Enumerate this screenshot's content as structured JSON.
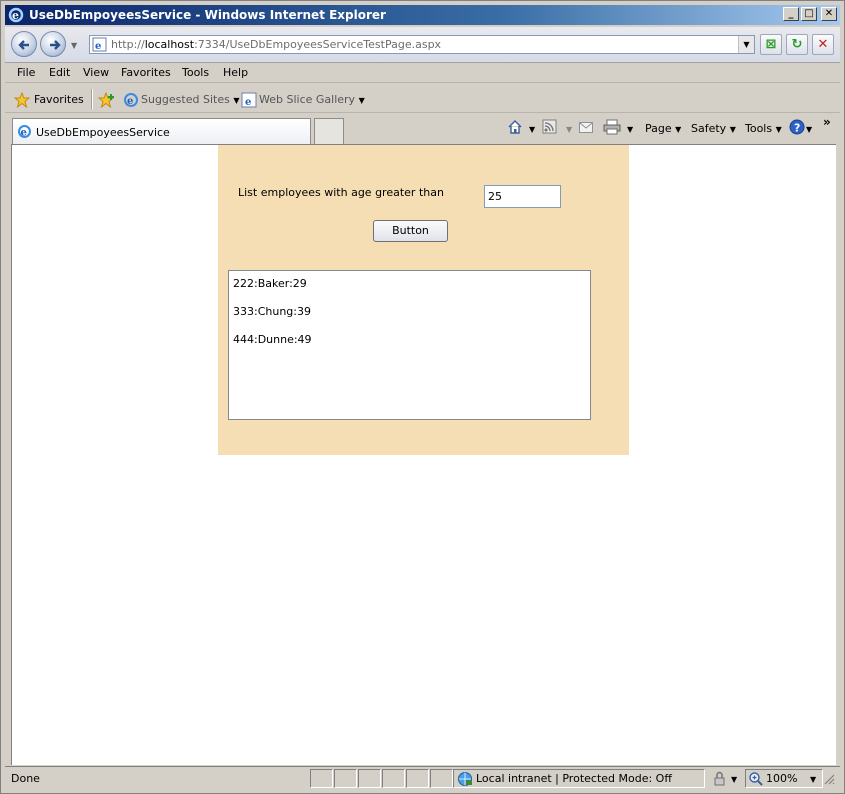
{
  "window": {
    "title": "UseDbEmpoyeesService - Windows Internet Explorer",
    "minimize": "_",
    "maximize": "□",
    "close": "✕"
  },
  "address_bar": {
    "url_prefix": "http://",
    "url_host": "localhost",
    "url_rest": ":7334/UseDbEmpoyeesServiceTestPage.aspx"
  },
  "menu": [
    "File",
    "Edit",
    "View",
    "Favorites",
    "Tools",
    "Help"
  ],
  "favorites_bar": {
    "favorites_label": "Favorites",
    "suggested_sites": "Suggested Sites",
    "web_slice_gallery": "Web Slice Gallery"
  },
  "tab": {
    "label": "UseDbEmpoyeesService"
  },
  "command_bar": {
    "page": "Page",
    "safety": "Safety",
    "tools": "Tools"
  },
  "app": {
    "prompt": "List employees with age greater than",
    "age_value": "25",
    "button_label": "Button",
    "results": [
      "222:Baker:29",
      "333:Chung:39",
      "444:Dunne:49"
    ]
  },
  "status_bar": {
    "status": "Done",
    "zone": "Local intranet | Protected Mode: Off",
    "zoom": "100%"
  },
  "colors": {
    "panel_bg": "#f5deb3",
    "title_gradient_start": "#0a246a"
  }
}
